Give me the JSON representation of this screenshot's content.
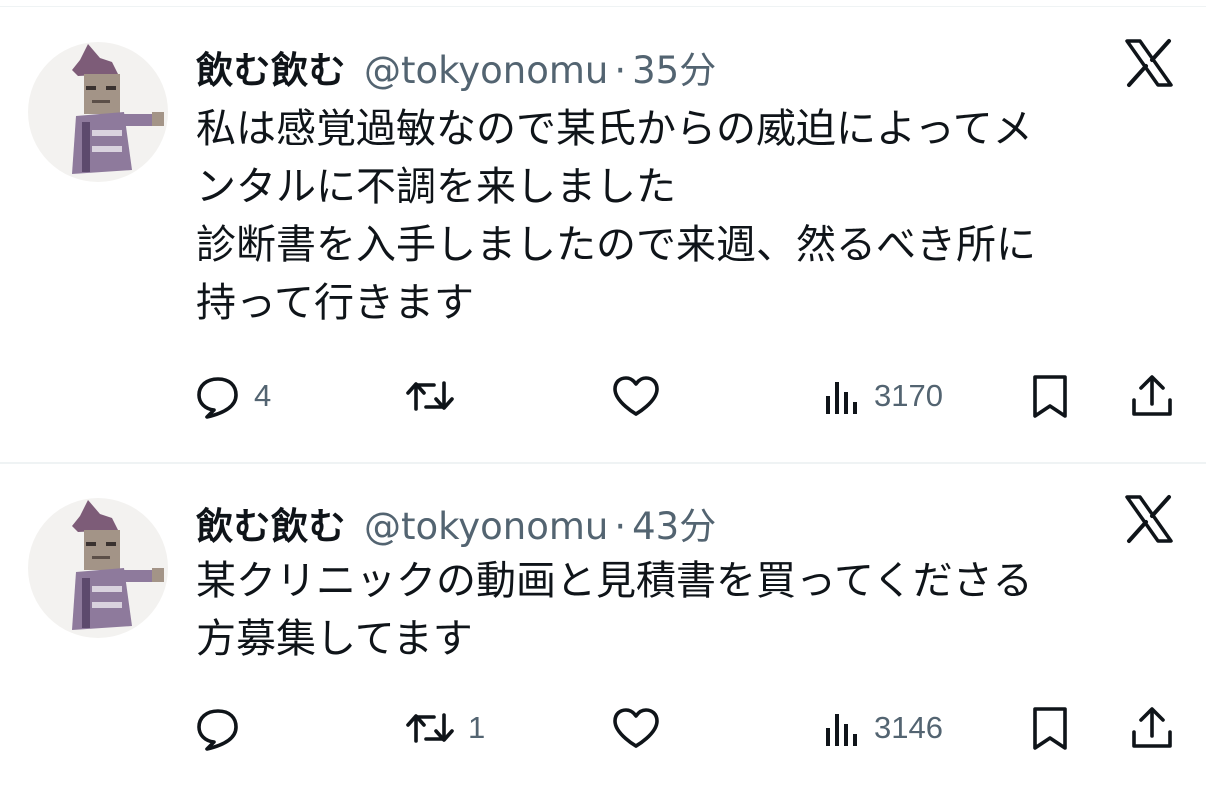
{
  "tweets": [
    {
      "display_name": "飲む飲む",
      "handle": "@tokyonomu",
      "separator": "·",
      "time": "35分",
      "text": "私は感覚過敏なので某氏からの威迫によってメ\nンタルに不調を来しました\n診断書を入手しましたので来週、然るべき所に\n持って行きます",
      "reply_count": "4",
      "retweet_count": "",
      "like_count": "",
      "view_count": "3170"
    },
    {
      "display_name": "飲む飲む",
      "handle": "@tokyonomu",
      "separator": "·",
      "time": "43分",
      "text": "某クリニックの動画と見積書を買ってくださる\n方募集してます",
      "reply_count": "",
      "retweet_count": "1",
      "like_count": "",
      "view_count": "3146"
    }
  ],
  "icons": [
    "x-logo",
    "reply-icon",
    "retweet-icon",
    "like-icon",
    "views-icon",
    "bookmark-icon",
    "share-icon"
  ],
  "colors": {
    "text": "#0f1419",
    "muted": "#536471",
    "divider": "#eff3f4"
  }
}
